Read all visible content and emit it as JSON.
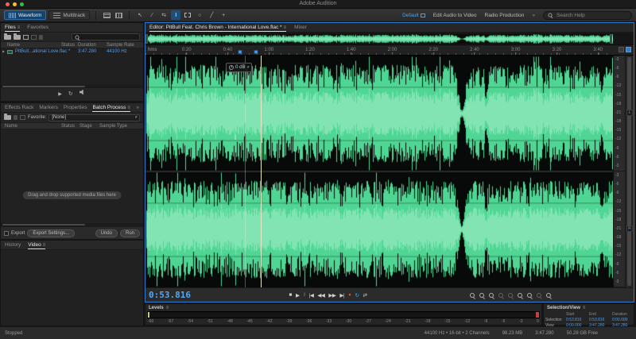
{
  "titlebar": {
    "title": "Adobe Audition"
  },
  "toolbar": {
    "view_buttons": [
      {
        "label": "Waveform"
      },
      {
        "label": "Multitrack"
      }
    ],
    "workspace": {
      "default_label": "Default",
      "items": [
        "Edit Audio to Video",
        "Radio Production"
      ],
      "search_placeholder": "Search Help"
    }
  },
  "files_panel": {
    "tabs": [
      "Files",
      "Favorites"
    ],
    "columns": [
      "Name",
      "Status",
      "Duration",
      "Sample Rate"
    ],
    "rows": [
      {
        "name": "PitBull...ational Love.flac *",
        "status": "",
        "duration": "3:47.280",
        "sample_rate": "44100 Hz"
      }
    ]
  },
  "batch_panel": {
    "tabs": [
      "Effects Rack",
      "Markers",
      "Properties",
      "Batch Process"
    ],
    "favorite_label": "Favorite:",
    "favorite_value": "[None]",
    "columns": [
      "Name",
      "Status",
      "Stage",
      "Sample Type"
    ],
    "empty_hint": "Drag and drop supported media files here",
    "export_label": "Export",
    "export_settings_label": "Export Settings...",
    "undo_label": "Undo",
    "run_label": "Run"
  },
  "history_panel": {
    "tabs": [
      "History",
      "Video"
    ]
  },
  "editor": {
    "tab_label": "Editor: PitBull Feat. Chris Brown - International Love.flac *",
    "mixer_label": "Mixer",
    "ruler_unit": "hms",
    "ruler_ticks": [
      "0:20",
      "0:40",
      "1:00",
      "1:20",
      "1:40",
      "2:00",
      "2:20",
      "2:40",
      "3:00",
      "3:20",
      "3:40"
    ],
    "hud_value": "0 dB",
    "channel_labels": [
      "L",
      "R"
    ],
    "db_labels": [
      "-3",
      "-6",
      "-9",
      "-12",
      "-15",
      "-18",
      "-21",
      "-18",
      "-15",
      "-12",
      "-9",
      "-6",
      "-3"
    ]
  },
  "transport": {
    "time": "0:53.816",
    "buttons": [
      {
        "name": "stop-button",
        "glyph": "■"
      },
      {
        "name": "play-button",
        "glyph": "▶"
      },
      {
        "name": "pause-button",
        "glyph": "‖",
        "dim": true
      },
      {
        "name": "move-to-previous-button",
        "glyph": "|◀"
      },
      {
        "name": "rewind-button",
        "glyph": "◀◀"
      },
      {
        "name": "fast-forward-button",
        "glyph": "▶▶"
      },
      {
        "name": "move-to-next-button",
        "glyph": "▶|"
      },
      {
        "name": "record-button",
        "glyph": "●",
        "color": "#d9453d"
      },
      {
        "name": "loop-playback-button",
        "glyph": "↻",
        "color": "#4aa3f0"
      },
      {
        "name": "skip-selection-button",
        "glyph": "⇄"
      }
    ],
    "zoom_tools": [
      {
        "name": "zoom-in-amplitude-button"
      },
      {
        "name": "zoom-out-amplitude-button"
      },
      {
        "name": "zoom-in-time-button"
      },
      {
        "name": "zoom-out-time-button",
        "dim": true
      },
      {
        "name": "zoom-in-at-in-point-button",
        "dim": true
      },
      {
        "name": "zoom-in-at-out-point-button"
      },
      {
        "name": "zoom-to-selection-button"
      },
      {
        "name": "zoom-out-full-button",
        "dim": true
      },
      {
        "name": "reset-zoom-button"
      }
    ]
  },
  "levels": {
    "title": "Levels",
    "scale": [
      "-60",
      "-57",
      "-54",
      "-51",
      "-48",
      "-45",
      "-42",
      "-39",
      "-36",
      "-33",
      "-30",
      "-27",
      "-24",
      "-21",
      "-18",
      "-15",
      "-12",
      "-9",
      "-6",
      "-3",
      "0"
    ]
  },
  "selection_view": {
    "title": "Selection/View",
    "columns": [
      "Start",
      "End",
      "Duration"
    ],
    "rows": [
      {
        "label": "Selection",
        "start": "0:53.816",
        "end": "0:53.816",
        "duration": "0:00.000"
      },
      {
        "label": "View",
        "start": "0:00.000",
        "end": "3:47.280",
        "duration": "3:47.280"
      }
    ]
  },
  "statusbar": {
    "status": "Stopped",
    "format": "44100 Hz • 16-bit • 2 Channels",
    "file_size": "98.23 MB",
    "file_duration": "3:47.280",
    "free_space": "50.28 GB Free"
  },
  "colors": {
    "accent_blue": "#3f9bf5",
    "waveform_green": "#4fd694",
    "record_red": "#d9453d",
    "frame_blue": "#2e7cd0"
  }
}
